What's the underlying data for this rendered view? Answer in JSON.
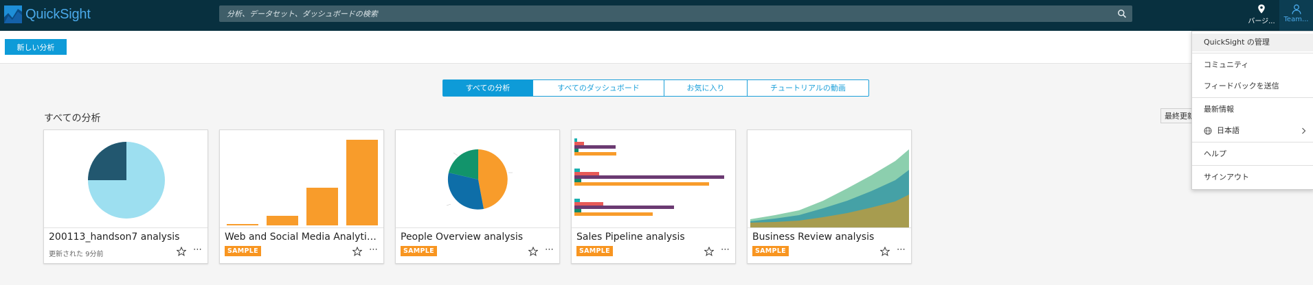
{
  "app": {
    "brand": "QuickSight",
    "search_placeholder": "分析、データセット、ダッシュボードの検索"
  },
  "nav": {
    "location_label": "バージ...",
    "team_label": "Team..."
  },
  "toolbar": {
    "new_analysis": "新しい分析"
  },
  "tabs": [
    {
      "label": "すべての分析",
      "active": true
    },
    {
      "label": "すべてのダッシュボード",
      "active": false
    },
    {
      "label": "お気に入り",
      "active": false
    },
    {
      "label": "チュートリアルの動画",
      "active": false
    }
  ],
  "section": {
    "title": "すべての分析",
    "sort_label": "最終更新"
  },
  "cards": [
    {
      "title": "200113_handson7 analysis",
      "subtitle": "更新された 9分前",
      "badge": ""
    },
    {
      "title": "Web and Social Media Analytics analysis",
      "subtitle": "",
      "badge": "SAMPLE"
    },
    {
      "title": "People Overview analysis",
      "subtitle": "",
      "badge": "SAMPLE"
    },
    {
      "title": "Sales Pipeline analysis",
      "subtitle": "",
      "badge": "SAMPLE"
    },
    {
      "title": "Business Review analysis",
      "subtitle": "",
      "badge": "SAMPLE"
    }
  ],
  "menu": {
    "items": [
      "QuickSight の管理",
      "コミュニティ",
      "フィードバックを送信",
      "最新情報",
      "日本語",
      "ヘルプ",
      "サインアウト"
    ]
  },
  "colors": {
    "topbar": "#08303f",
    "accent": "#0e9bd8",
    "sample_badge": "#f89520"
  }
}
